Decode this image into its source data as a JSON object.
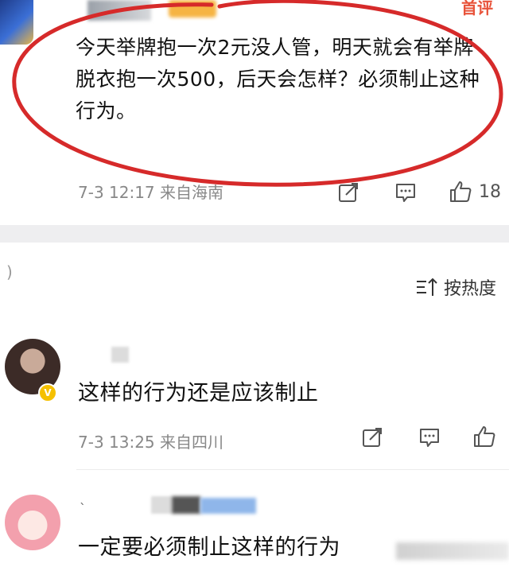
{
  "post": {
    "top_badge": "首评",
    "text": "今天举牌抱一次2元没人管，明天就会有举牌脱衣抱一次500，后天会怎样？必须制止这种行为。",
    "meta": "7-3 12:17 来自海南",
    "like_count": "18"
  },
  "sort": {
    "label": "按热度"
  },
  "comments": [
    {
      "text": "这样的行为还是应该制止",
      "meta": "7-3 13:25 来自四川"
    },
    {
      "text": "一定要必须制止这样的行为"
    }
  ],
  "icons": {
    "repost": "repost-icon",
    "comment": "comment-icon",
    "like": "thumbs-up-icon",
    "sort": "sort-icon",
    "verified": "verified-badge-icon"
  },
  "colors": {
    "annotation_red": "#d62a2a",
    "accent_orange": "#e8533a"
  }
}
